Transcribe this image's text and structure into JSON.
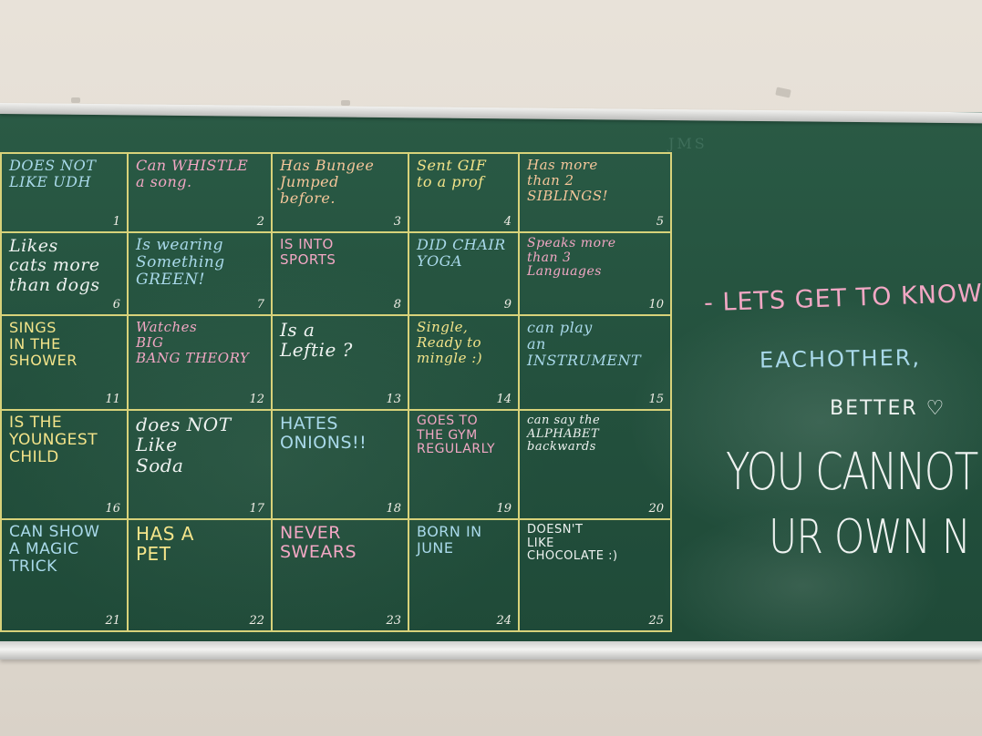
{
  "board": {
    "initials": "JMS",
    "colors": {
      "board": "#23503d",
      "grid_lines": "#d8d27a",
      "wall": "#e4ddd3",
      "frame": "#dcdcda"
    },
    "bingo_cells": [
      {
        "text": "DOES NOT\nLIKE UDH",
        "number": "1",
        "color": "#a9d9ea"
      },
      {
        "text": "Can WHISTLE\na song.",
        "number": "2",
        "color": "#f2a7c4"
      },
      {
        "text": "Has Bungee\nJumped\nbefore.",
        "number": "3",
        "color": "#f5c69a"
      },
      {
        "text": "Sent GIF\nto a prof",
        "number": "4",
        "color": "#f4e48a"
      },
      {
        "text": "Has more\nthan 2\nSIBLINGS!",
        "number": "5",
        "color": "#f5c69a"
      },
      {
        "text": "Likes\ncats more\nthan dogs",
        "number": "6",
        "color": "#eef2f0"
      },
      {
        "text": "Is wearing\nSomething\nGREEN!",
        "number": "7",
        "color": "#a9d9ea"
      },
      {
        "text": "IS INTO\nSPORTS",
        "number": "8",
        "color": "#f2a7c4"
      },
      {
        "text": "DID CHAIR\nYOGA",
        "number": "9",
        "color": "#a9d9ea"
      },
      {
        "text": "Speaks more\nthan 3\nLanguages",
        "number": "10",
        "color": "#f2a7c4"
      },
      {
        "text": "SINGS\nIN THE\nSHOWER",
        "number": "11",
        "color": "#f4e48a"
      },
      {
        "text": "Watches\nBIG\nBANG THEORY",
        "number": "12",
        "color": "#f2a7c4"
      },
      {
        "text": "Is a\nLeftie ?",
        "number": "13",
        "color": "#eef2f0"
      },
      {
        "text": "Single,\nReady to\nmingle :)",
        "number": "14",
        "color": "#f4e48a"
      },
      {
        "text": "can play\nan\nINSTRUMENT",
        "number": "15",
        "color": "#a9d9ea"
      },
      {
        "text": "IS THE\nYOUNGEST\nCHILD",
        "number": "16",
        "color": "#f4e48a"
      },
      {
        "text": "does NOT\nLike\nSoda",
        "number": "17",
        "color": "#eef2f0"
      },
      {
        "text": "HATES\nONIONS!!",
        "number": "18",
        "color": "#a9d9ea"
      },
      {
        "text": "GOES TO\nTHE GYM\nREGULARLY",
        "number": "19",
        "color": "#f2a7c4"
      },
      {
        "text": "can say the\nALPHABET\nbackwards",
        "number": "20",
        "color": "#eef2f0"
      },
      {
        "text": "CAN SHOW\nA MAGIC\nTRICK",
        "number": "21",
        "color": "#a9d9ea"
      },
      {
        "text": "HAS A\nPET",
        "number": "22",
        "color": "#f4e48a"
      },
      {
        "text": "NEVER\nSWEARS",
        "number": "23",
        "color": "#f2a7c4"
      },
      {
        "text": "BORN IN\nJUNE",
        "number": "24",
        "color": "#a9d9ea"
      },
      {
        "text": "DOESN'T\nLIKE\nCHOCOLATE :)",
        "number": "25",
        "color": "#eef2f0"
      }
    ],
    "message": {
      "line1": "- LETS GET TO KNOW",
      "line2": "EACHOTHER,",
      "line3": "BETTER ♡",
      "line4": "YOU CANNOT",
      "line5": "UR OWN N"
    }
  }
}
